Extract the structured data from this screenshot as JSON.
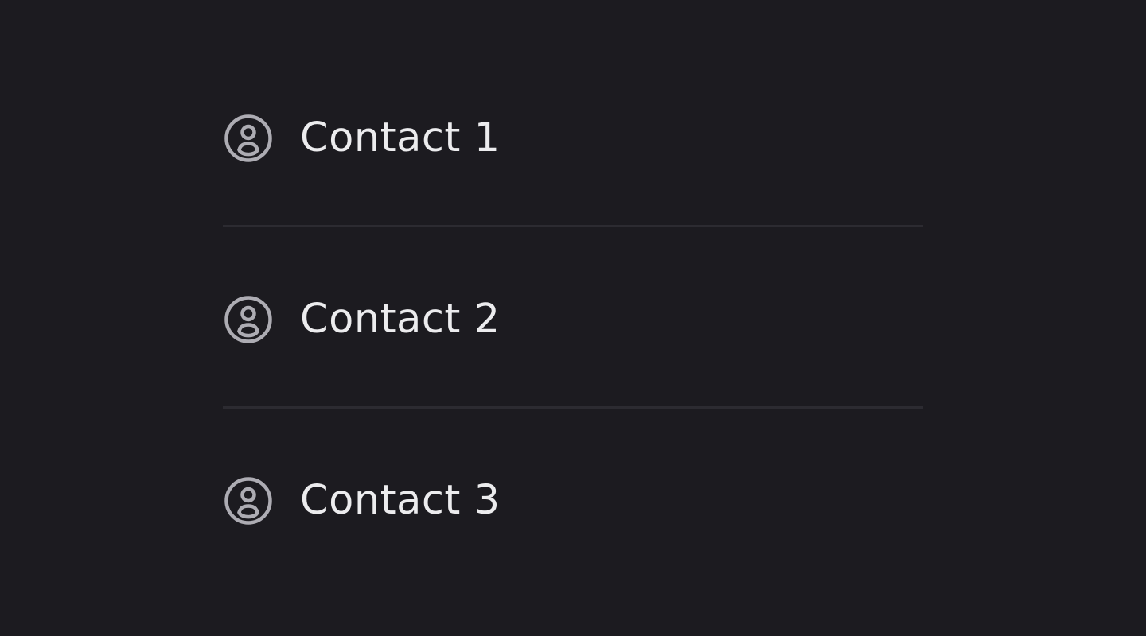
{
  "contacts": {
    "items": [
      {
        "label": "Contact 1",
        "icon": "user-circle-icon"
      },
      {
        "label": "Contact 2",
        "icon": "user-circle-icon"
      },
      {
        "label": "Contact 3",
        "icon": "user-circle-icon"
      }
    ]
  },
  "colors": {
    "background": "#1c1b20",
    "divider": "#2c2b31",
    "icon": "#adacb3",
    "text": "#ececee"
  }
}
